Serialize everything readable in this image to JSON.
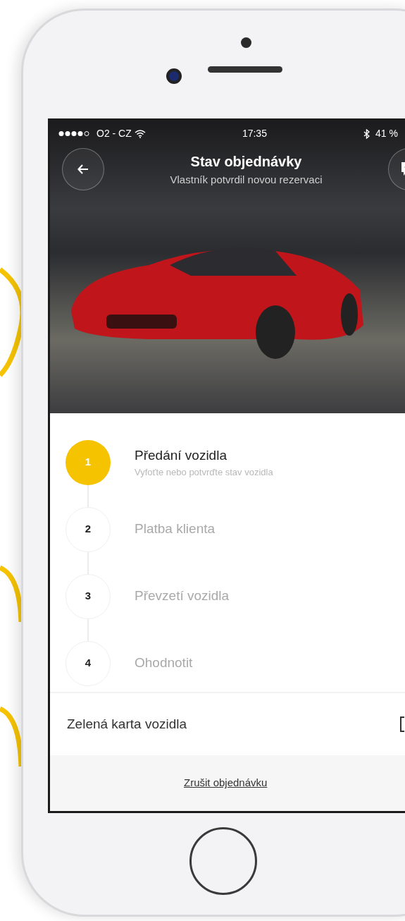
{
  "status_bar": {
    "carrier": "O2 - CZ",
    "time": "17:35",
    "battery": "41 %"
  },
  "header": {
    "title": "Stav objednávky",
    "subtitle": "Vlastník potvrdil novou rezervaci"
  },
  "steps": [
    {
      "number": "1",
      "title": "Předání vozidla",
      "subtitle": "Vyfoťte nebo potvrďte stav vozidla",
      "active": true
    },
    {
      "number": "2",
      "title": "Platba klienta",
      "active": false
    },
    {
      "number": "3",
      "title": "Převzetí vozidla",
      "active": false
    },
    {
      "number": "4",
      "title": "Ohodnotit",
      "active": false
    }
  ],
  "document_row": {
    "label": "Zelená karta vozidla"
  },
  "cancel_link": "Zrušit objednávku"
}
